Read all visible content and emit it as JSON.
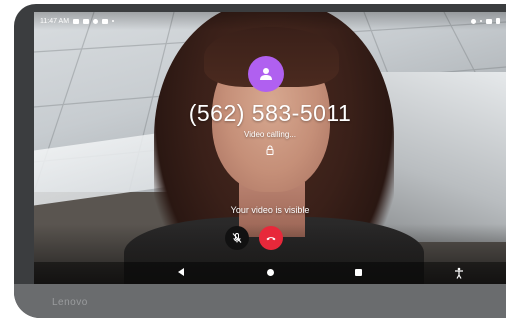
{
  "status_bar": {
    "time": "11:47 AM"
  },
  "call": {
    "phone_number": "(562) 583-5011",
    "status": "Video calling...",
    "video_visible_notice": "Your video is visible"
  },
  "device": {
    "brand": "Lenovo"
  },
  "colors": {
    "avatar": "#b060f0",
    "end_call": "#e8283a",
    "mute_button": "#111111"
  },
  "icons": {
    "avatar": "person-icon",
    "lock": "lock-icon",
    "mute": "mic-off-icon",
    "end_call": "end-call-icon",
    "nav_back": "back-icon",
    "nav_home": "home-icon",
    "nav_recents": "recents-icon",
    "nav_accessibility": "accessibility-icon"
  }
}
